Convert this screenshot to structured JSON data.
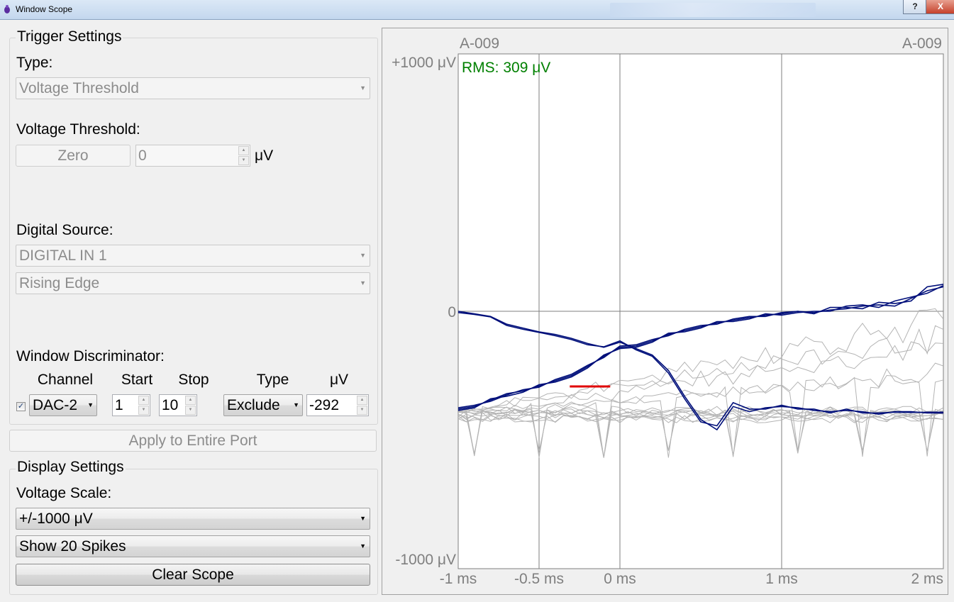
{
  "window": {
    "title": "Window Scope",
    "help_label": "?",
    "close_label": "X"
  },
  "trigger": {
    "group_title": "Trigger Settings",
    "type_label": "Type:",
    "type_value": "Voltage Threshold",
    "threshold_label": "Voltage Threshold:",
    "zero_label": "Zero",
    "threshold_value": "0",
    "threshold_unit": "μV",
    "digital_label": "Digital Source:",
    "digital_source": "DIGITAL IN 1",
    "edge": "Rising Edge"
  },
  "discriminator": {
    "title": "Window Discriminator:",
    "headers": {
      "channel": "Channel",
      "start": "Start",
      "stop": "Stop",
      "type": "Type",
      "uv": "μV"
    },
    "channel": "DAC-2",
    "start": "1",
    "stop": "10",
    "type": "Exclude",
    "uv": "-292",
    "enabled": true
  },
  "apply_label": "Apply to Entire Port",
  "display": {
    "group_title": "Display Settings",
    "scale_label": "Voltage Scale:",
    "scale_value": "+/-1000 μV",
    "spikes_value": "Show 20 Spikes",
    "clear_label": "Clear Scope"
  },
  "chart_data": {
    "type": "line",
    "channel_left": "A-009",
    "channel_right": "A-009",
    "rms_text": "RMS: 309 μV",
    "x_range": [
      -1,
      2
    ],
    "y_range": [
      -1000,
      1000
    ],
    "x_ticks": [
      {
        "v": -1,
        "label": "-1 ms"
      },
      {
        "v": -0.5,
        "label": "-0.5 ms"
      },
      {
        "v": 0,
        "label": "0 ms"
      },
      {
        "v": 1,
        "label": "1 ms"
      },
      {
        "v": 2,
        "label": "2 ms"
      }
    ],
    "y_ticks": [
      {
        "v": 1000,
        "label": "+1000 μV"
      },
      {
        "v": 0,
        "label": "0"
      },
      {
        "v": -1000,
        "label": "-1000 μV"
      }
    ],
    "grid_x": [
      -0.5,
      0,
      1
    ],
    "grid_y": [
      0
    ],
    "discriminator_window": {
      "t_start": -0.31,
      "t_stop": -0.06,
      "uv": -292
    },
    "colors": {
      "spike": "#000f7a",
      "noise": "#b4b4b4",
      "discriminator": "#e00000",
      "rms": "#008000",
      "axis": "#7f7f7f"
    },
    "series": [
      {
        "x": [
          -1,
          -0.9,
          -0.8,
          -0.7,
          -0.6,
          -0.5,
          -0.4,
          -0.3,
          -0.2,
          -0.1,
          0,
          0.1,
          0.2,
          0.3,
          0.4,
          0.5,
          0.6,
          0.7,
          0.8,
          0.9,
          1,
          1.1,
          1.2,
          1.3,
          1.4,
          1.5,
          1.6,
          1.7,
          1.8,
          1.9,
          2
        ],
        "y": [
          0,
          -10,
          -20,
          -50,
          -65,
          -80,
          -90,
          -105,
          -125,
          -140,
          -120,
          -145,
          -170,
          -230,
          -330,
          -420,
          -460,
          -370,
          -390,
          -375,
          -370,
          -375,
          -385,
          -390,
          -385,
          -390,
          -400,
          -390,
          -390,
          -395,
          -395
        ]
      },
      {
        "x": [
          -1,
          -0.9,
          -0.8,
          -0.7,
          -0.6,
          -0.5,
          -0.4,
          -0.3,
          -0.2,
          -0.1,
          0,
          0.1,
          0.2,
          0.3,
          0.4,
          0.5,
          0.6,
          0.7,
          0.8,
          0.9,
          1,
          1.1,
          1.2,
          1.3,
          1.4,
          1.5,
          1.6,
          1.7,
          1.8,
          1.9,
          2
        ],
        "y": [
          -5,
          -12,
          -22,
          -55,
          -70,
          -82,
          -95,
          -110,
          -130,
          -138,
          -115,
          -150,
          -175,
          -240,
          -340,
          -430,
          -445,
          -355,
          -380,
          -380,
          -365,
          -380,
          -380,
          -395,
          -380,
          -395,
          -395,
          -392,
          -393,
          -392,
          -392
        ]
      },
      {
        "x": [
          -1,
          -0.9,
          -0.8,
          -0.7,
          -0.6,
          -0.5,
          -0.4,
          -0.3,
          -0.2,
          -0.1,
          0,
          0.1,
          0.2,
          0.3,
          0.4,
          0.5,
          0.6,
          0.7,
          0.8,
          0.9,
          1,
          1.1,
          1.2,
          1.3,
          1.4,
          1.5,
          1.6,
          1.7,
          1.8,
          1.9,
          2
        ],
        "y": [
          -380,
          -370,
          -345,
          -320,
          -310,
          -290,
          -270,
          -250,
          -215,
          -175,
          -140,
          -135,
          -115,
          -90,
          -75,
          -60,
          -45,
          -35,
          -25,
          -15,
          -10,
          0,
          -5,
          5,
          10,
          20,
          25,
          20,
          50,
          80,
          95
        ]
      },
      {
        "x": [
          -1,
          -0.9,
          -0.8,
          -0.7,
          -0.6,
          -0.5,
          -0.4,
          -0.3,
          -0.2,
          -0.1,
          0,
          0.1,
          0.2,
          0.3,
          0.4,
          0.5,
          0.6,
          0.7,
          0.8,
          0.9,
          1,
          1.1,
          1.2,
          1.3,
          1.4,
          1.5,
          1.6,
          1.7,
          1.8,
          1.9,
          2
        ],
        "y": [
          -375,
          -365,
          -350,
          -325,
          -305,
          -295,
          -265,
          -245,
          -210,
          -180,
          -135,
          -130,
          -110,
          -95,
          -70,
          -55,
          -50,
          -30,
          -20,
          -20,
          -5,
          0,
          -10,
          15,
          15,
          10,
          35,
          30,
          40,
          95,
          105
        ]
      },
      {
        "x": [
          -1,
          -0.9,
          -0.8,
          -0.7,
          -0.6,
          -0.5,
          -0.4,
          -0.3,
          -0.2,
          -0.1,
          0,
          0.1,
          0.2,
          0.3,
          0.4,
          0.5,
          0.6,
          0.7,
          0.8,
          0.9,
          1,
          1.1,
          1.2,
          1.3,
          1.4,
          1.5,
          1.6,
          1.7,
          1.8,
          1.9,
          2
        ],
        "y": [
          -385,
          -375,
          -340,
          -330,
          -315,
          -285,
          -275,
          -255,
          -220,
          -170,
          -145,
          -140,
          -120,
          -85,
          -80,
          -65,
          -40,
          -40,
          -30,
          -10,
          -15,
          -5,
          0,
          0,
          20,
          25,
          15,
          40,
          55,
          70,
          100
        ]
      }
    ]
  }
}
